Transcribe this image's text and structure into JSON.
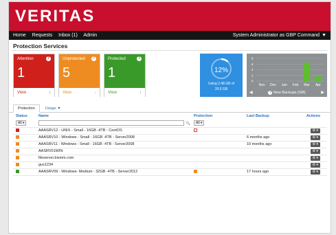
{
  "brand": {
    "logo": "VERITAS",
    "color": "#c8102e"
  },
  "nav": {
    "items": [
      "Home",
      "Requests",
      "Inbox (1)",
      "Admin"
    ],
    "user_label": "System Administrator as GBP Command",
    "user_caret": "▼"
  },
  "page": {
    "title": "Protection Services"
  },
  "cards": {
    "attention": {
      "label": "Attention",
      "count": "1",
      "view": "View",
      "color": "#d0201c"
    },
    "unprotected": {
      "label": "Unprotected",
      "count": "5",
      "view": "View",
      "color": "#ee8c22"
    },
    "protected": {
      "label": "Protected",
      "count": "1",
      "view": "View",
      "color": "#3a9a29"
    },
    "help_glyph": "?",
    "view_arrow": "↓"
  },
  "usage": {
    "percent_text": "12%",
    "percent": 12,
    "line1": "Using 2.48 GB of",
    "line2": "20.5 GB"
  },
  "backups_chart": {
    "caption": "New Backups (GB)",
    "help_glyph": "?",
    "prev": "◀",
    "next": "▶",
    "chart_data": {
      "type": "bar",
      "categories": [
        "Nov",
        "Dec",
        "Jan",
        "Feb",
        "Mar",
        "Apr"
      ],
      "values": [
        0,
        0,
        0,
        0,
        6.5,
        1.7
      ],
      "y_ticks": [
        "0",
        "2",
        "4",
        "6",
        "8"
      ],
      "ylim": [
        0,
        8
      ],
      "bar_color": "#5dbf2e"
    }
  },
  "tabs": [
    {
      "label": "Protection",
      "active": true
    },
    {
      "label": "Usage",
      "caret": "▼",
      "active": false
    }
  ],
  "table": {
    "headers": {
      "status": "Status",
      "name": "Name",
      "protection": "Protection",
      "last_backup": "Last Backup",
      "actions": "Actions"
    },
    "filter": {
      "all_label": "All ▾",
      "search_glyph": "🔍"
    },
    "action_label": "⚙ ▾",
    "rows": [
      {
        "status_color": "#d0201c",
        "name": "AAASRV12 - UNIX - Small - 16GB -4TB - CentOS",
        "protection": "unchecked",
        "last_backup": ""
      },
      {
        "status_color": "#ee8c22",
        "name": "AAASRV10 - Windows - Small - 16GB -4TB - Server2008",
        "protection": "",
        "last_backup": "6 months ago"
      },
      {
        "status_color": "#ee8c22",
        "name": "AAASRV11 - Windows - Small - 16GB -4TB - Server2008",
        "protection": "",
        "last_backup": "10 months ago"
      },
      {
        "status_color": "#ee8c22",
        "name": "AASRV01WIN",
        "protection": "",
        "last_backup": ""
      },
      {
        "status_color": "#ee8c22",
        "name": "fileserver.bismni.com",
        "protection": "",
        "last_backup": ""
      },
      {
        "status_color": "#ee8c22",
        "name": "gus1234",
        "protection": "",
        "last_backup": ""
      },
      {
        "status_color": "#3a9a29",
        "name": "AAASRV09 - Windows- Medium - 32GB -4TB - Server2012",
        "protection": "checked",
        "last_backup": "17 hours ago"
      }
    ]
  }
}
